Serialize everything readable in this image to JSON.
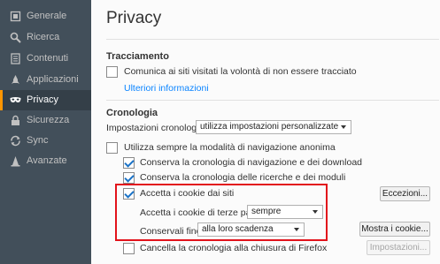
{
  "sidebar": {
    "items": [
      {
        "label": "Generale",
        "icon": "gear-icon"
      },
      {
        "label": "Ricerca",
        "icon": "search-icon"
      },
      {
        "label": "Contenuti",
        "icon": "document-icon"
      },
      {
        "label": "Applicazioni",
        "icon": "rocket-icon"
      },
      {
        "label": "Privacy",
        "icon": "mask-icon",
        "active": true
      },
      {
        "label": "Sicurezza",
        "icon": "lock-icon"
      },
      {
        "label": "Sync",
        "icon": "sync-icon"
      },
      {
        "label": "Avanzate",
        "icon": "wizard-icon"
      }
    ]
  },
  "main": {
    "title": "Privacy",
    "tracking": {
      "heading": "Tracciamento",
      "dnt_label": "Comunica ai siti visitati la volontà di non essere tracciato",
      "more_info": "Ulteriori informazioni"
    },
    "history": {
      "heading": "Cronologia",
      "settings_label": "Impostazioni cronologia:",
      "settings_value": "utilizza impostazioni personalizzate",
      "private_mode": "Utilizza sempre la modalità di navigazione anonima",
      "keep_browsing": "Conserva la cronologia di navigazione e dei download",
      "keep_search": "Conserva la cronologia delle ricerche e dei moduli",
      "accept_cookies": "Accetta i cookie dai siti",
      "exceptions_button": "Eccezioni...",
      "third_party_label": "Accetta i cookie di terze parti:",
      "third_party_value": "sempre",
      "keep_until_label": "Conservali fino:",
      "keep_until_value": "alla loro scadenza",
      "show_cookies_button": "Mostra i cookie...",
      "clear_on_close": "Cancella la cronologia alla chiusura di Firefox",
      "settings_button": "Impostazioni..."
    }
  },
  "colors": {
    "sidebar_bg": "#424f5a",
    "sidebar_active_bg": "#343f48",
    "accent": "#ff9500",
    "link": "#0a84ff",
    "highlight": "#e2131b"
  }
}
